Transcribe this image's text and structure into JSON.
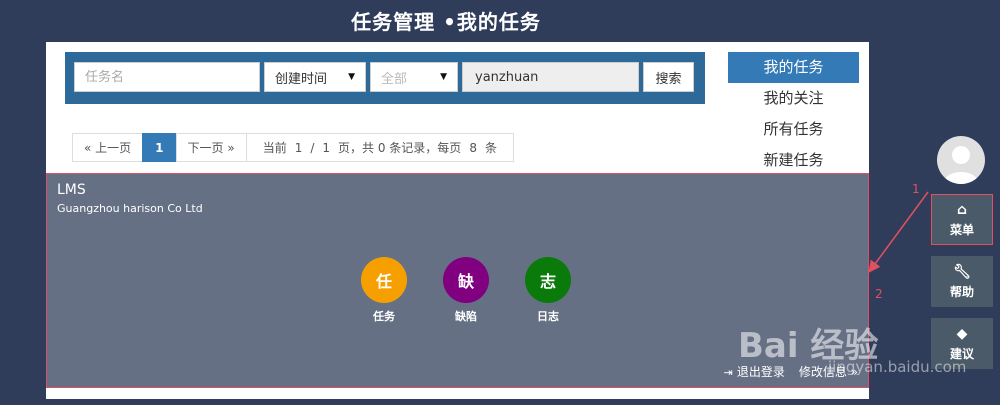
{
  "header": {
    "title": "任务管理 •我的任务"
  },
  "search": {
    "task_name_placeholder": "任务名",
    "sort_value": "创建时间",
    "status_value": "全部",
    "user_value": "yanzhuan",
    "search_label": "搜索"
  },
  "side_nav": {
    "items": [
      {
        "label": "我的任务"
      },
      {
        "label": "我的关注"
      },
      {
        "label": "所有任务"
      },
      {
        "label": "新建任务"
      }
    ]
  },
  "pagination": {
    "prev_label": "« 上一页",
    "current_page": "1",
    "next_label": "下一页 »",
    "info_prefix": "当前",
    "info_current": "1",
    "info_sep": "/",
    "info_total_pages": "1",
    "info_mid": "页，共 0 条记录，每页",
    "info_per_page": "8",
    "info_suffix": "条"
  },
  "overlay": {
    "brand_name": "LMS",
    "brand_sub": "Guangzhou harison Co Ltd",
    "apps": [
      {
        "glyph": "任",
        "label": "任务",
        "color": "#f5a000"
      },
      {
        "glyph": "缺",
        "label": "缺陷",
        "color": "#800080"
      },
      {
        "glyph": "志",
        "label": "日志",
        "color": "#0a7a0a"
      }
    ],
    "logout_label": "退出登录",
    "other_label": "修改信息 »"
  },
  "right_rail": {
    "menu_label": "菜单",
    "help_label": "帮助",
    "suggest_label": "建议"
  },
  "annotations": {
    "one": "1",
    "two": "2"
  },
  "watermark": {
    "text": "Bai 经验",
    "url": "jingyan.baidu.com"
  },
  "icons": {
    "menu": "home-icon",
    "help": "wrench-icon",
    "suggest": "tag-icon",
    "logout": "logout-icon",
    "caret": "caret-down-icon"
  }
}
